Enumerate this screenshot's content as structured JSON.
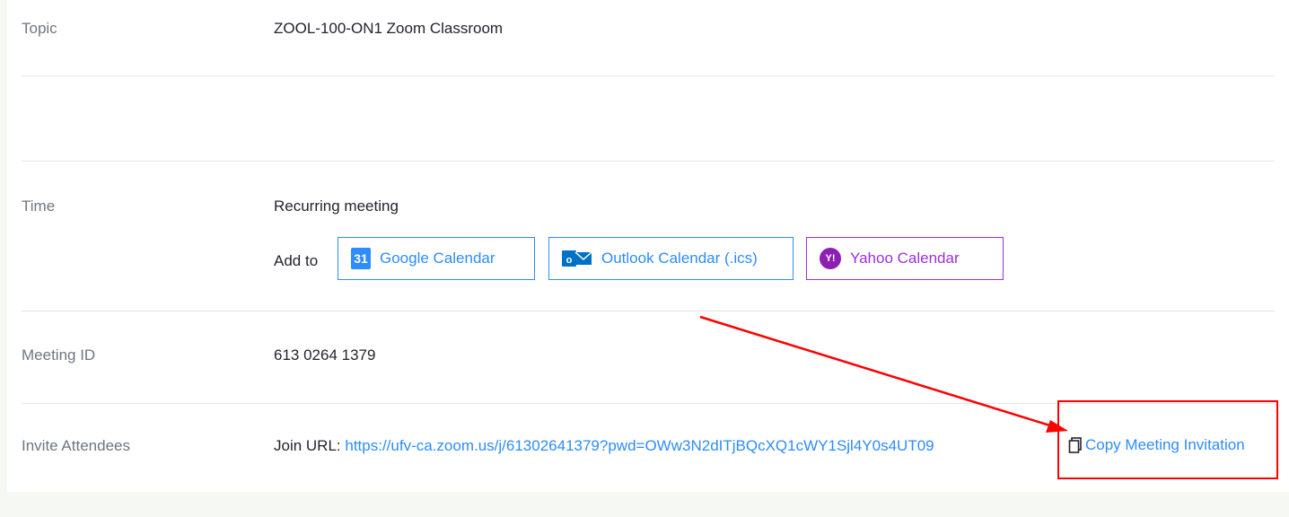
{
  "topic": {
    "label": "Topic",
    "value": "ZOOL-100-ON1 Zoom Classroom"
  },
  "time": {
    "label": "Time",
    "value": "Recurring meeting",
    "add_to_label": "Add to",
    "buttons": {
      "google": {
        "label": "Google Calendar",
        "icon_text": "31",
        "icon": "google-calendar-icon"
      },
      "outlook": {
        "label": "Outlook Calendar (.ics)",
        "icon_text": "o",
        "icon": "outlook-icon"
      },
      "yahoo": {
        "label": "Yahoo Calendar",
        "icon_text": "Y!",
        "icon": "yahoo-icon"
      }
    }
  },
  "meeting_id": {
    "label": "Meeting ID",
    "value": "613 0264 1379"
  },
  "invite": {
    "label": "Invite Attendees",
    "join_prefix": "Join URL:",
    "join_url": "https://ufv-ca.zoom.us/j/61302641379?pwd=OWw3N2dITjBQcXQ1cWY1Sjl4Y0s4UT09",
    "copy_label": "Copy Meeting Invitation",
    "copy_icon": "copy-icon"
  },
  "colors": {
    "accent": "#2d8cff",
    "yahoo": "#9b30d9",
    "annotation": "#ff0000"
  }
}
